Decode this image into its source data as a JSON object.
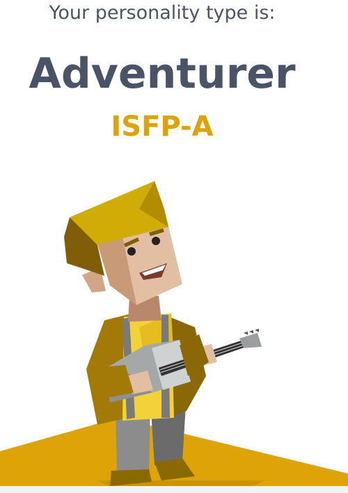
{
  "result": {
    "intro": "Your personality type is:",
    "type_name": "Adventurer",
    "type_code": "ISFP-A"
  },
  "illustration": {
    "subject": "adventurer-character-with-guitar"
  },
  "colors": {
    "heading": "#4a5468",
    "accent": "#dda307",
    "ground": "#dda307"
  }
}
